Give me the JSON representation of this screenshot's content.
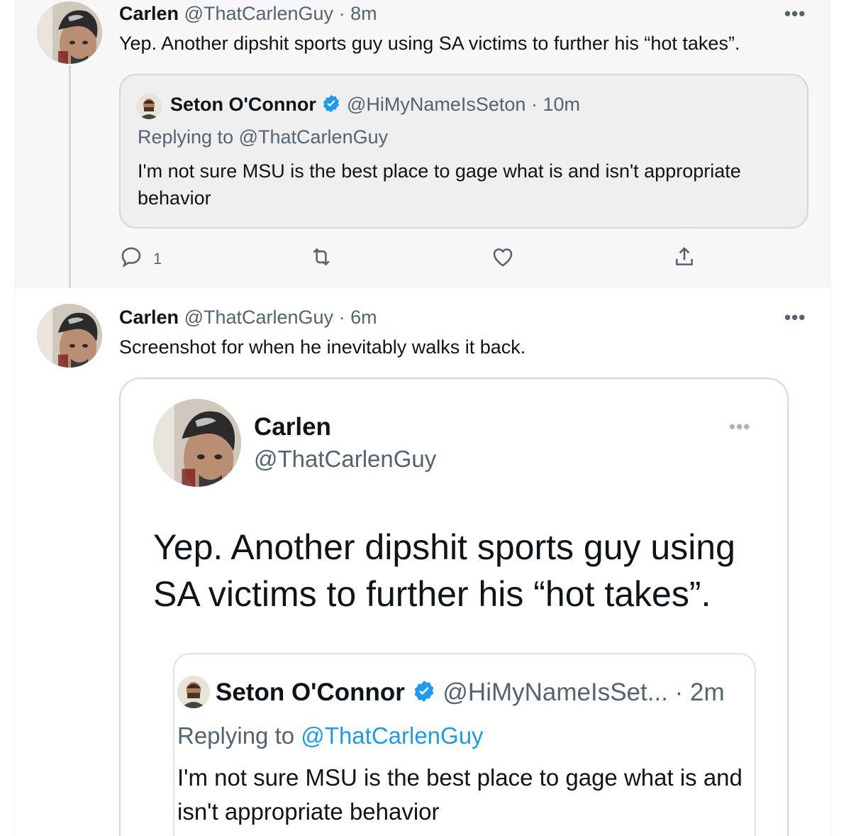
{
  "tweet1": {
    "name": "Carlen",
    "handle": "@ThatCarlenGuy",
    "time": "8m",
    "text": "Yep. Another dipshit sports guy using SA victims to further his “hot takes”.",
    "more": "•••",
    "quote": {
      "name": "Seton O'Connor",
      "handle": "@HiMyNameIsSeton",
      "time": "10m",
      "replying_prefix": "Replying to",
      "replying_handle": "@ThatCarlenGuy",
      "text": "I'm not sure MSU is the best place to gage what is and isn't appropriate behavior"
    },
    "actions": {
      "reply_count": "1",
      "icons": [
        "reply-icon",
        "retweet-icon",
        "like-icon",
        "share-icon"
      ]
    }
  },
  "tweet2": {
    "name": "Carlen",
    "handle": "@ThatCarlenGuy",
    "time": "6m",
    "text": "Screenshot for when he inevitably walks it back.",
    "more": "•••",
    "screenshot": {
      "name": "Carlen",
      "handle": "@ThatCarlenGuy",
      "more": "•••",
      "text": "Yep. Another dipshit sports guy using SA victims to further his “hot takes”.",
      "quote": {
        "name": "Seton O'Connor",
        "handle": "@HiMyNameIsSet...",
        "time": "2m",
        "replying_prefix": "Replying to",
        "replying_handle": "@ThatCarlenGuy",
        "text": "I'm not sure MSU is the best place to gage what is and isn't appropriate behavior"
      }
    }
  },
  "colors": {
    "accent": "#1d9bf0",
    "secondary_text": "#536471",
    "border": "#cfd9de",
    "highlight_bg": "#f7f7f7"
  }
}
